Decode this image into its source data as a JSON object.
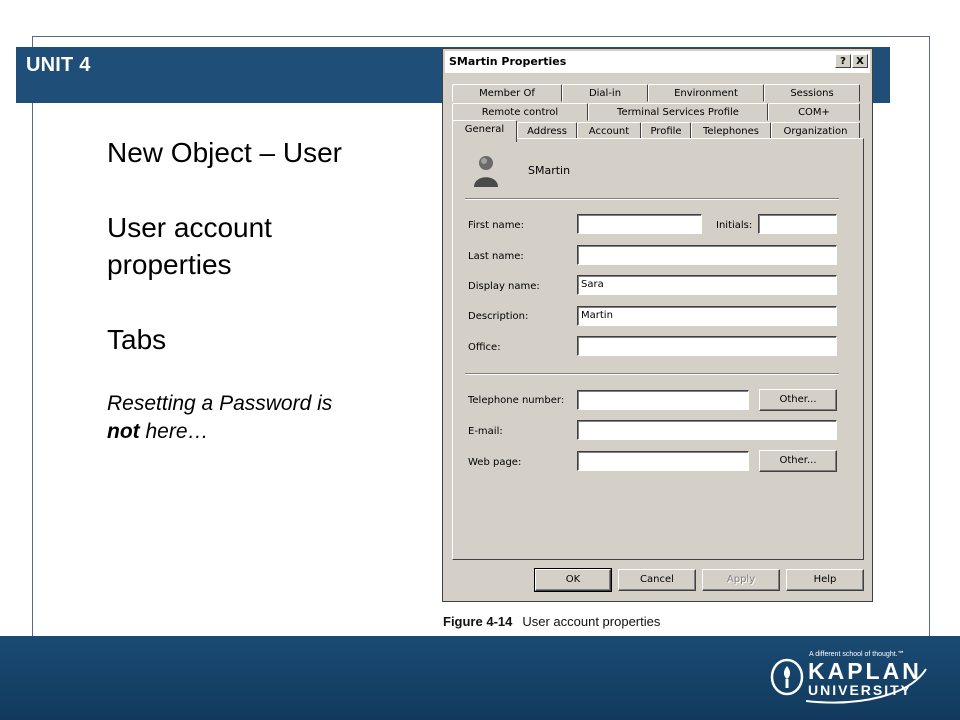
{
  "slide": {
    "unit_label": "UNIT 4",
    "bullets": [
      "New Object – User",
      "User account properties",
      "Tabs"
    ],
    "note_prefix": "Resetting a Password is ",
    "note_bold": "not",
    "note_suffix": " here…",
    "caption_figure": "Figure 4-14",
    "caption_text": "User account properties"
  },
  "dialog": {
    "title": "SMartin Properties",
    "help_btn": "?",
    "close_btn": "X",
    "tabs_row1": [
      "Member Of",
      "Dial-in",
      "Environment",
      "Sessions"
    ],
    "tabs_row2": [
      "Remote control",
      "Terminal Services Profile",
      "COM+"
    ],
    "tabs_row3": [
      "General",
      "Address",
      "Account",
      "Profile",
      "Telephones",
      "Organization"
    ],
    "active_tab": "General",
    "username": "SMartin",
    "fields": {
      "first_name": {
        "label": "First name:",
        "value": ""
      },
      "initials": {
        "label": "Initials:",
        "value": ""
      },
      "last_name": {
        "label": "Last name:",
        "value": ""
      },
      "display_name": {
        "label": "Display name:",
        "value": "Sara"
      },
      "description": {
        "label": "Description:",
        "value": "Martin"
      },
      "office": {
        "label": "Office:",
        "value": ""
      },
      "telephone": {
        "label": "Telephone number:",
        "value": ""
      },
      "email": {
        "label": "E-mail:",
        "value": ""
      },
      "web_page": {
        "label": "Web page:",
        "value": ""
      }
    },
    "other_btn": "Other...",
    "buttons": {
      "ok": "OK",
      "cancel": "Cancel",
      "apply": "Apply",
      "help": "Help"
    }
  },
  "footer": {
    "tagline": "A different school of thought.℠",
    "logo_top": "KAPLAN",
    "logo_bottom": "UNIVERSITY"
  },
  "colors": {
    "header_bar": "#1f4e79",
    "footer": "#1a4a73",
    "dialog_face": "#d4d0c8"
  }
}
